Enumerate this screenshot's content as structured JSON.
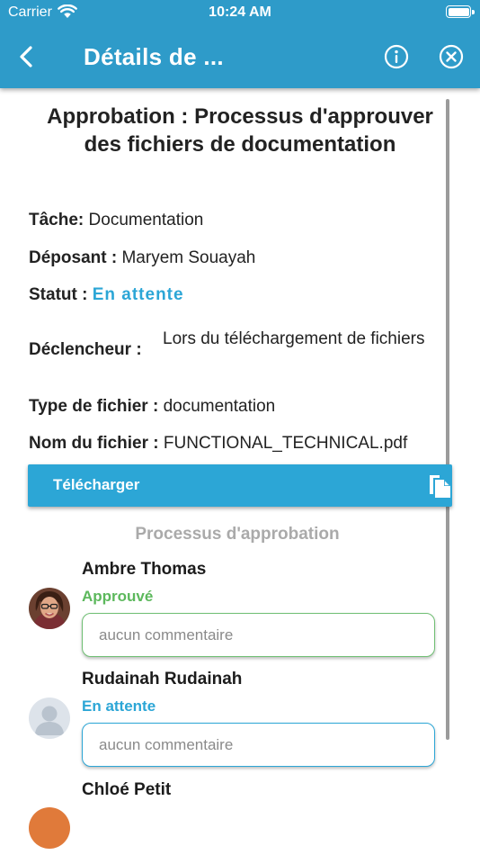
{
  "status_bar": {
    "carrier": "Carrier",
    "time": "10:24 AM"
  },
  "nav": {
    "title": "Détails de ...",
    "back_icon": "chevron-left-icon",
    "info_icon": "info-icon",
    "close_icon": "close-circle-icon"
  },
  "heading": "Approbation : Processus d'approuver des fichiers de documentation",
  "details": {
    "task_label": "Tâche:",
    "task_value": "Documentation",
    "depositor_label": "Déposant :",
    "depositor_value": "Maryem Souayah",
    "status_label": "Statut :",
    "status_value": "En attente",
    "trigger_label": "Déclencheur :",
    "trigger_value": "Lors du téléchargement de fichiers",
    "filetype_label": "Type de fichier :",
    "filetype_value": "documentation",
    "filename_label": "Nom du fichier :",
    "filename_value": "FUNCTIONAL_TECHNICAL.pdf"
  },
  "download": {
    "label": "Télécharger",
    "icon": "copy-document-icon"
  },
  "process_title": "Processus d'approbation",
  "approvers": [
    {
      "name": "Ambre Thomas",
      "state": "Approuvé",
      "comment_placeholder": "aucun commentaire"
    },
    {
      "name": "Rudainah Rudainah",
      "state": "En attente",
      "comment_placeholder": "aucun commentaire"
    },
    {
      "name": "Chloé Petit"
    }
  ],
  "colors": {
    "nav": "#2e9bc9",
    "accent": "#2ca6d6",
    "approved": "#5cb85c",
    "section_title": "#aaaaaa"
  }
}
